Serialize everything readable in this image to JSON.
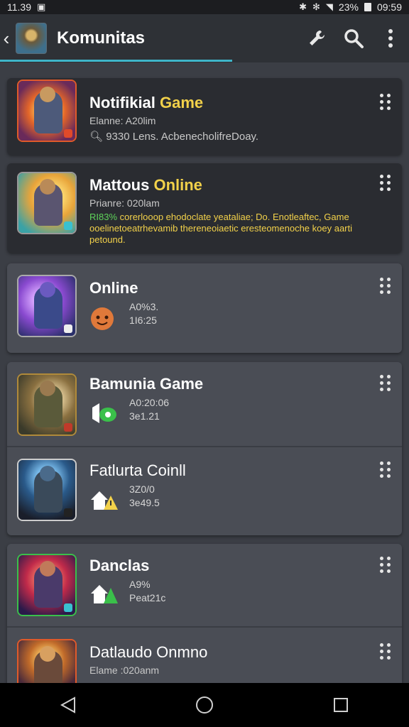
{
  "status": {
    "time": "11.39",
    "battery": "23%",
    "clock": "09:59"
  },
  "appbar": {
    "title": "Komunitas"
  },
  "cards": [
    {
      "title_main": "Notifikial ",
      "title_accent": "Game",
      "sub": "Elanne: A20lim",
      "line": "9330 Lens. AcbenecholifreDoay."
    },
    {
      "title_main": "Mattous ",
      "title_accent": "Online",
      "sub": "Prianre: 020lam",
      "desc_green": "RI83% ",
      "desc": "corerlooop ehodoclate yeataliae; Do. Enotleaftec, Game ooelinetoeatrhevamib thereneoiaetic eresteomenoche koey aarti petound."
    },
    {
      "title_main": "Online",
      "stat1": "A0%3.",
      "stat2": "1I6:25"
    },
    {
      "title_main": "Bamunia Game",
      "stat1": "A0:20:06",
      "stat2": "3e1.21"
    },
    {
      "title_main": "Fatlurta Coinll",
      "stat1": "3Z0/0",
      "stat2": "3e49.5"
    },
    {
      "title_main": "Danclas",
      "stat1": "A9%",
      "stat2": "Peat21c"
    },
    {
      "title_main": "Datlaudo Onmno",
      "sub": "Elame :020anm"
    }
  ]
}
